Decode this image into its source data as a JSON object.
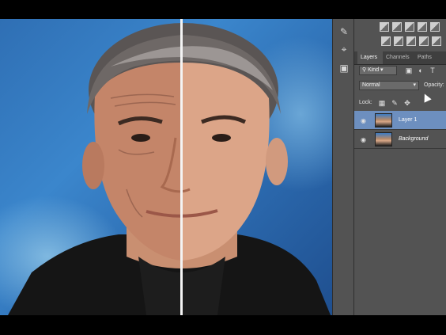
{
  "tools": {
    "icons": [
      "history-brush-icon",
      "clone-stamp-icon",
      "layer-comps-icon"
    ]
  },
  "adjustments": {
    "icons": [
      "brightness-icon",
      "levels-icon",
      "curves-icon",
      "exposure-icon",
      "vibrance-icon",
      "hue-saturation-icon",
      "color-balance-icon",
      "black-white-icon",
      "photo-filter-icon",
      "channel-mixer-icon",
      "invert-icon"
    ]
  },
  "layers_panel": {
    "tabs": [
      {
        "label": "Layers",
        "active": true
      },
      {
        "label": "Channels",
        "active": false
      },
      {
        "label": "Paths",
        "active": false
      }
    ],
    "filter_kind": "Kind",
    "blend_mode": "Normal",
    "opacity_label": "Opacity:",
    "lock_label": "Lock:",
    "layers": [
      {
        "name": "Layer 1",
        "selected": true,
        "visible": true
      },
      {
        "name": "Background",
        "selected": false,
        "visible": true,
        "italic": true
      }
    ]
  },
  "colors": {
    "panel_bg": "#535353",
    "panel_dark": "#3f3f3f",
    "selection": "#6d8fbf",
    "canvas_blue": "#3b86cc"
  }
}
